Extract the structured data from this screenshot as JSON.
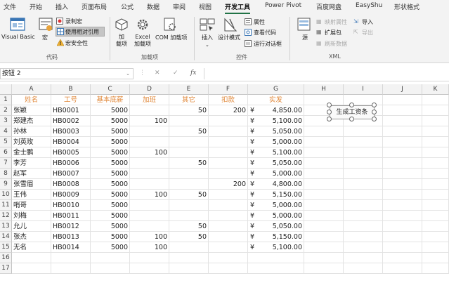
{
  "menu": {
    "tabs": [
      "文件",
      "开始",
      "插入",
      "页面布局",
      "公式",
      "数据",
      "审阅",
      "视图",
      "开发工具",
      "Power Pivot",
      "百度网盘",
      "EasyShu",
      "形状格式"
    ],
    "active": "开发工具"
  },
  "ribbon": {
    "code": {
      "visual_basic": "Visual Basic",
      "macro": "宏",
      "record_macro": "录制宏",
      "relative_ref": "使用相对引用",
      "macro_security": "宏安全性",
      "label": "代码"
    },
    "addins": {
      "addin": "加\n载项",
      "excel_addin": "Excel\n加载项",
      "com_addin": "COM 加载项",
      "label": "加载项"
    },
    "controls": {
      "insert": "插入",
      "design_mode": "设计模式",
      "properties": "属性",
      "view_code": "查看代码",
      "run_dialog": "运行对话框",
      "label": "控件"
    },
    "xml": {
      "source": "源",
      "map_properties": "映射属性",
      "expansion_packs": "扩展包",
      "refresh_data": "刷新数据",
      "import": "导入",
      "export": "导出",
      "label": "XML"
    }
  },
  "formula_bar": {
    "name_box": "按钮 2",
    "fx": "fx",
    "content": ""
  },
  "columns": [
    "A",
    "B",
    "C",
    "D",
    "E",
    "F",
    "G",
    "H",
    "I",
    "J",
    "K"
  ],
  "rows": [
    "1",
    "2",
    "3",
    "4",
    "5",
    "6",
    "7",
    "8",
    "9",
    "10",
    "11",
    "12",
    "13",
    "14",
    "15",
    "16",
    "17"
  ],
  "table": {
    "headers": [
      "姓名",
      "工号",
      "基本底薪",
      "加班",
      "其它",
      "扣款",
      "实发"
    ],
    "data": [
      [
        "张颖",
        "HB0001",
        "5000",
        "",
        "50",
        "200",
        "4,850.00"
      ],
      [
        "郑建杰",
        "HB0002",
        "5000",
        "100",
        "",
        "",
        "5,100.00"
      ],
      [
        "孙林",
        "HB0003",
        "5000",
        "",
        "50",
        "",
        "5,050.00"
      ],
      [
        "刘英玫",
        "HB0004",
        "5000",
        "",
        "",
        "",
        "5,000.00"
      ],
      [
        "金士鹏",
        "HB0005",
        "5000",
        "100",
        "",
        "",
        "5,100.00"
      ],
      [
        "李芳",
        "HB0006",
        "5000",
        "",
        "50",
        "",
        "5,050.00"
      ],
      [
        "赵军",
        "HB0007",
        "5000",
        "",
        "",
        "",
        "5,000.00"
      ],
      [
        "张雪眉",
        "HB0008",
        "5000",
        "",
        "",
        "200",
        "4,800.00"
      ],
      [
        "王伟",
        "HB0009",
        "5000",
        "100",
        "50",
        "",
        "5,150.00"
      ],
      [
        "哨哥",
        "HB0010",
        "5000",
        "",
        "",
        "",
        "5,000.00"
      ],
      [
        "刘梅",
        "HB0011",
        "5000",
        "",
        "",
        "",
        "5,000.00"
      ],
      [
        "允儿",
        "HB0012",
        "5000",
        "",
        "50",
        "",
        "5,050.00"
      ],
      [
        "张杰",
        "HB0013",
        "5000",
        "100",
        "50",
        "",
        "5,150.00"
      ],
      [
        "无名",
        "HB0014",
        "5000",
        "100",
        "",
        "",
        "5,100.00"
      ]
    ],
    "currency_symbol": "¥"
  },
  "form_button": {
    "label": "生成工资条"
  },
  "colors": {
    "accent": "#217346",
    "header_text": "#e0883a"
  }
}
